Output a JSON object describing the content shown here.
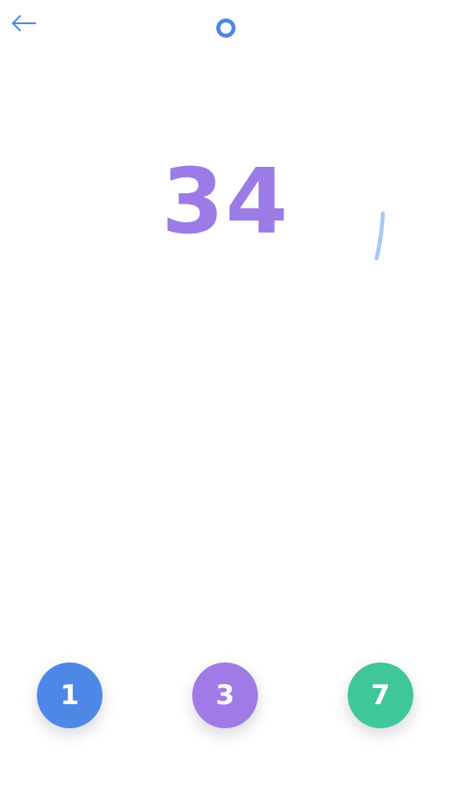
{
  "header": {
    "back_icon": "arrow-left-icon",
    "indicator_icon": "ring-icon",
    "accent_color": "#4f86e3"
  },
  "game": {
    "target_number": "34",
    "target_color": "#9b7be6",
    "hint_mark_color": "#a8c8f0"
  },
  "choices": [
    {
      "label": "1",
      "color": "#4e88e6"
    },
    {
      "label": "3",
      "color": "#a07be6"
    },
    {
      "label": "7",
      "color": "#3fc79a"
    }
  ]
}
